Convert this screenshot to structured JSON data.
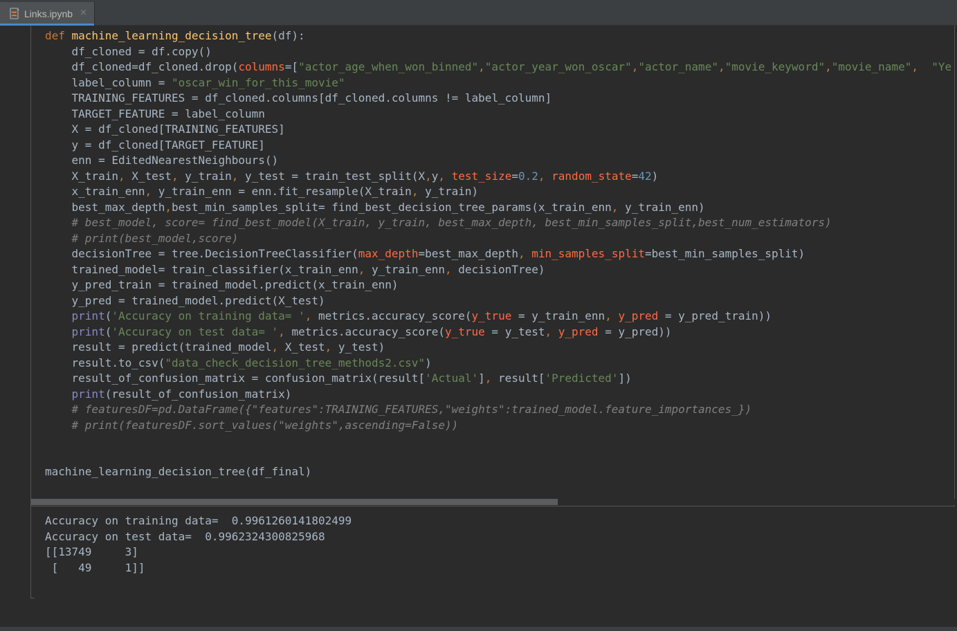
{
  "tab": {
    "label": "Links.ipynb",
    "close": "×",
    "icon": "jupyter-notebook-icon"
  },
  "code_lines": [
    [
      {
        "t": "def ",
        "c": "kw"
      },
      {
        "t": "machine_learning_decision_tree",
        "c": "fn"
      },
      {
        "t": "(df):",
        "c": ""
      }
    ],
    [
      {
        "t": "    df_cloned = df.copy()",
        "c": ""
      }
    ],
    [
      {
        "t": "    df_cloned=df_cloned.drop(",
        "c": ""
      },
      {
        "t": "columns",
        "c": "param"
      },
      {
        "t": "=[",
        "c": ""
      },
      {
        "t": "\"actor_age_when_won_binned\"",
        "c": "str"
      },
      {
        "t": ",",
        "c": "comma"
      },
      {
        "t": "\"actor_year_won_oscar\"",
        "c": "str"
      },
      {
        "t": ",",
        "c": "comma"
      },
      {
        "t": "\"actor_name\"",
        "c": "str"
      },
      {
        "t": ",",
        "c": "comma"
      },
      {
        "t": "\"movie_keyword\"",
        "c": "str"
      },
      {
        "t": ",",
        "c": "comma"
      },
      {
        "t": "\"movie_name\"",
        "c": "str"
      },
      {
        "t": ",  ",
        "c": "comma"
      },
      {
        "t": "\"Ye",
        "c": "str"
      }
    ],
    [
      {
        "t": "    label_column = ",
        "c": ""
      },
      {
        "t": "\"oscar_win_for_this_movie\"",
        "c": "str"
      }
    ],
    [
      {
        "t": "    TRAINING_FEATURES = df_cloned.columns[df_cloned.columns != label_column]",
        "c": ""
      }
    ],
    [
      {
        "t": "    TARGET_FEATURE = label_column",
        "c": ""
      }
    ],
    [
      {
        "t": "    X = df_cloned[TRAINING_FEATURES]",
        "c": ""
      }
    ],
    [
      {
        "t": "    y = df_cloned[TARGET_FEATURE]",
        "c": ""
      }
    ],
    [
      {
        "t": "    enn = EditedNearestNeighbours()",
        "c": ""
      }
    ],
    [
      {
        "t": "    X_train",
        "c": ""
      },
      {
        "t": ", ",
        "c": "comma"
      },
      {
        "t": "X_test",
        "c": ""
      },
      {
        "t": ", ",
        "c": "comma"
      },
      {
        "t": "y_train",
        "c": ""
      },
      {
        "t": ", ",
        "c": "comma"
      },
      {
        "t": "y_test = train_test_split(X",
        "c": ""
      },
      {
        "t": ",",
        "c": "comma"
      },
      {
        "t": "y",
        "c": ""
      },
      {
        "t": ", ",
        "c": "comma"
      },
      {
        "t": "test_size",
        "c": "param"
      },
      {
        "t": "=",
        "c": ""
      },
      {
        "t": "0.2",
        "c": "num"
      },
      {
        "t": ", ",
        "c": "comma"
      },
      {
        "t": "random_state",
        "c": "param"
      },
      {
        "t": "=",
        "c": ""
      },
      {
        "t": "42",
        "c": "num"
      },
      {
        "t": ")",
        "c": ""
      }
    ],
    [
      {
        "t": "    x_train_enn",
        "c": ""
      },
      {
        "t": ", ",
        "c": "comma"
      },
      {
        "t": "y_train_enn = enn.fit_resample(X_train",
        "c": ""
      },
      {
        "t": ", ",
        "c": "comma"
      },
      {
        "t": "y_train)",
        "c": ""
      }
    ],
    [
      {
        "t": "    best_max_depth",
        "c": ""
      },
      {
        "t": ",",
        "c": "comma"
      },
      {
        "t": "best_min_samples_split= find_best_decision_tree_params(x_train_enn",
        "c": ""
      },
      {
        "t": ", ",
        "c": "comma"
      },
      {
        "t": "y_train_enn)",
        "c": ""
      }
    ],
    [
      {
        "t": "    # best_model, score= find_best_model(X_train, y_train, best_max_depth, best_min_samples_split,best_num_estimators)",
        "c": "cmt"
      }
    ],
    [
      {
        "t": "    # print(best_model,score)",
        "c": "cmt"
      }
    ],
    [
      {
        "t": "    decisionTree = tree.DecisionTreeClassifier(",
        "c": ""
      },
      {
        "t": "max_depth",
        "c": "param"
      },
      {
        "t": "=best_max_depth",
        "c": ""
      },
      {
        "t": ", ",
        "c": "comma"
      },
      {
        "t": "min_samples_split",
        "c": "param"
      },
      {
        "t": "=best_min_samples_split)",
        "c": ""
      }
    ],
    [
      {
        "t": "    trained_model= train_classifier(x_train_enn",
        "c": ""
      },
      {
        "t": ", ",
        "c": "comma"
      },
      {
        "t": "y_train_enn",
        "c": ""
      },
      {
        "t": ", ",
        "c": "comma"
      },
      {
        "t": "decisionTree)",
        "c": ""
      }
    ],
    [
      {
        "t": "    y_pred_train = trained_model.predict(x_train_enn)",
        "c": ""
      }
    ],
    [
      {
        "t": "    y_pred = trained_model.predict(X_test)",
        "c": ""
      }
    ],
    [
      {
        "t": "    ",
        "c": ""
      },
      {
        "t": "print",
        "c": "builtin"
      },
      {
        "t": "(",
        "c": ""
      },
      {
        "t": "'Accuracy on training data= '",
        "c": "str"
      },
      {
        "t": ", ",
        "c": "comma"
      },
      {
        "t": "metrics.accuracy_score(",
        "c": ""
      },
      {
        "t": "y_true",
        "c": "param"
      },
      {
        "t": " = y_train_enn",
        "c": ""
      },
      {
        "t": ", ",
        "c": "comma"
      },
      {
        "t": "y_pred",
        "c": "param"
      },
      {
        "t": " = y_pred_train))",
        "c": ""
      }
    ],
    [
      {
        "t": "    ",
        "c": ""
      },
      {
        "t": "print",
        "c": "builtin"
      },
      {
        "t": "(",
        "c": ""
      },
      {
        "t": "'Accuracy on test data= '",
        "c": "str"
      },
      {
        "t": ", ",
        "c": "comma"
      },
      {
        "t": "metrics.accuracy_score(",
        "c": ""
      },
      {
        "t": "y_true",
        "c": "param"
      },
      {
        "t": " = y_test",
        "c": ""
      },
      {
        "t": ", ",
        "c": "comma"
      },
      {
        "t": "y_pred",
        "c": "param"
      },
      {
        "t": " = y_pred))",
        "c": ""
      }
    ],
    [
      {
        "t": "    result = predict(trained_model",
        "c": ""
      },
      {
        "t": ", ",
        "c": "comma"
      },
      {
        "t": "X_test",
        "c": ""
      },
      {
        "t": ", ",
        "c": "comma"
      },
      {
        "t": "y_test)",
        "c": ""
      }
    ],
    [
      {
        "t": "    result.to_csv(",
        "c": ""
      },
      {
        "t": "\"data_check_decision_tree_methods2.csv\"",
        "c": "str"
      },
      {
        "t": ")",
        "c": ""
      }
    ],
    [
      {
        "t": "    result_of_confusion_matrix = confusion_matrix(result[",
        "c": ""
      },
      {
        "t": "'Actual'",
        "c": "str"
      },
      {
        "t": "]",
        "c": ""
      },
      {
        "t": ", ",
        "c": "comma"
      },
      {
        "t": "result[",
        "c": ""
      },
      {
        "t": "'Predicted'",
        "c": "str"
      },
      {
        "t": "])",
        "c": ""
      }
    ],
    [
      {
        "t": "    ",
        "c": ""
      },
      {
        "t": "print",
        "c": "builtin"
      },
      {
        "t": "(result_of_confusion_matrix)",
        "c": ""
      }
    ],
    [
      {
        "t": "    # featuresDF=pd.DataFrame({\"features\":TRAINING_FEATURES,\"weights\":trained_model.feature_importances_})",
        "c": "cmt"
      }
    ],
    [
      {
        "t": "    # print(featuresDF.sort_values(\"weights\",ascending=False))",
        "c": "cmt"
      }
    ],
    [
      {
        "t": "",
        "c": ""
      }
    ],
    [
      {
        "t": "",
        "c": ""
      }
    ],
    [
      {
        "t": "machine_learning_decision_tree(df_final)",
        "c": ""
      }
    ]
  ],
  "output_lines": [
    "Accuracy on training data=  0.9961260141802499",
    "Accuracy on test data=  0.9962324300825968",
    "[[13749     3]",
    " [   49     1]]"
  ]
}
